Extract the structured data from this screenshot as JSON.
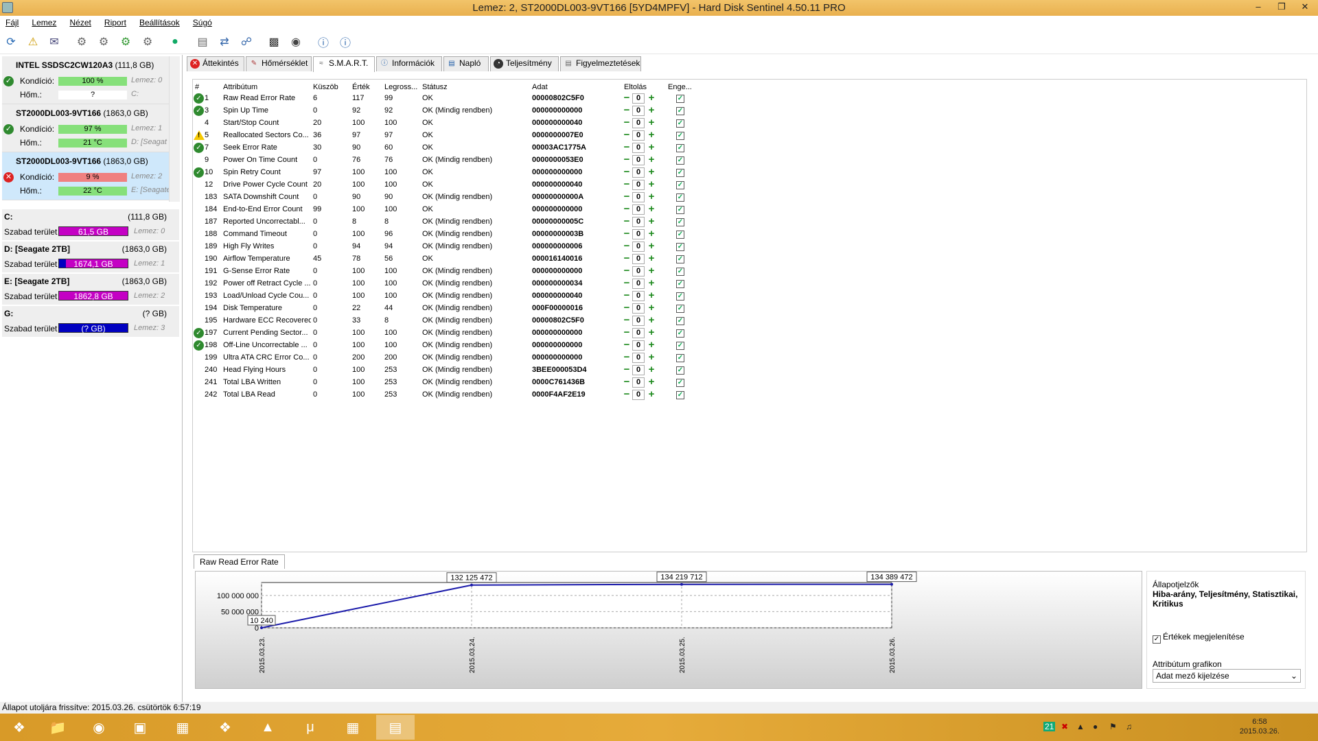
{
  "window": {
    "title": "Lemez: 2, ST2000DL003-9VT166 [5YD4MPFV]  -  Hard Disk Sentinel 4.50.11 PRO"
  },
  "menu": [
    "Fájl",
    "Lemez",
    "Nézet",
    "Riport",
    "Beállítások",
    "Súgó"
  ],
  "disks": [
    {
      "name": "INTEL SSDSC2CW120A3",
      "size": "(111,8 GB)",
      "cond_label": "Kondíció:",
      "cond_value": "100 %",
      "disk_ref": "Lemez: 0",
      "temp_label": "Hőm.:",
      "temp_value": "?",
      "vol_ref": "C:",
      "status": "ok",
      "cond_color": "#86e07a",
      "temp_color": "#fff"
    },
    {
      "name": "ST2000DL003-9VT166",
      "size": "(1863,0 GB)",
      "cond_label": "Kondíció:",
      "cond_value": "97 %",
      "disk_ref": "Lemez: 1",
      "temp_label": "Hőm.:",
      "temp_value": "21 °C",
      "vol_ref": "D: [Seagat",
      "status": "ok",
      "cond_color": "#86e07a",
      "temp_color": "#86e07a"
    },
    {
      "name": "ST2000DL003-9VT166",
      "size": "(1863,0 GB)",
      "cond_label": "Kondíció:",
      "cond_value": "9 %",
      "disk_ref": "Lemez: 2",
      "temp_label": "Hőm.:",
      "temp_value": "22 °C",
      "vol_ref": "E: [Seagate",
      "status": "error",
      "cond_color": "#f08080",
      "temp_color": "#86e07a"
    }
  ],
  "volumes": [
    {
      "name": "C:",
      "size": "(111,8 GB)",
      "free_label": "Szabad terület",
      "free_value": "61,5 GB",
      "disk_ref": "Lemez: 0",
      "color": "#c400c4"
    },
    {
      "name": "D: [Seagate 2TB]",
      "size": "(1863,0 GB)",
      "free_label": "Szabad terület",
      "free_value": "1674,1 GB",
      "disk_ref": "Lemez: 1",
      "color": "#c400c4"
    },
    {
      "name": "E: [Seagate 2TB]",
      "size": "(1863,0 GB)",
      "free_label": "Szabad terület",
      "free_value": "1862,8 GB",
      "disk_ref": "Lemez: 2",
      "color": "#c400c4"
    },
    {
      "name": "G:",
      "size": "(? GB)",
      "free_label": "Szabad terület",
      "free_value": "(? GB)",
      "disk_ref": "Lemez: 3",
      "color": "#0000c0"
    }
  ],
  "tabs": [
    "Áttekintés",
    "Hőmérséklet",
    "S.M.A.R.T.",
    "Információk",
    "Napló",
    "Teljesítmény",
    "Figyelmeztetések"
  ],
  "smart_headers": [
    "#",
    "Attribútum",
    "Küszöb",
    "Érték",
    "Legross...",
    "Státusz",
    "Adat",
    "Eltolás",
    "Enge..."
  ],
  "smart_rows": [
    {
      "icon": "ok",
      "id": "1",
      "name": "Raw Read Error Rate",
      "thr": "6",
      "val": "117",
      "worst": "99",
      "status": "OK",
      "data": "00000802C5F0",
      "offset": "0"
    },
    {
      "icon": "ok",
      "id": "3",
      "name": "Spin Up Time",
      "thr": "0",
      "val": "92",
      "worst": "92",
      "status": "OK (Mindig rendben)",
      "data": "000000000000",
      "offset": "0"
    },
    {
      "icon": "",
      "id": "4",
      "name": "Start/Stop Count",
      "thr": "20",
      "val": "100",
      "worst": "100",
      "status": "OK",
      "data": "000000000040",
      "offset": "0"
    },
    {
      "icon": "warn",
      "id": "5",
      "name": "Reallocated Sectors Co...",
      "thr": "36",
      "val": "97",
      "worst": "97",
      "status": "OK",
      "data": "0000000007E0",
      "offset": "0"
    },
    {
      "icon": "ok",
      "id": "7",
      "name": "Seek Error Rate",
      "thr": "30",
      "val": "90",
      "worst": "60",
      "status": "OK",
      "data": "00003AC1775A",
      "offset": "0"
    },
    {
      "icon": "",
      "id": "9",
      "name": "Power On Time Count",
      "thr": "0",
      "val": "76",
      "worst": "76",
      "status": "OK (Mindig rendben)",
      "data": "0000000053E0",
      "offset": "0"
    },
    {
      "icon": "ok",
      "id": "10",
      "name": "Spin Retry Count",
      "thr": "97",
      "val": "100",
      "worst": "100",
      "status": "OK",
      "data": "000000000000",
      "offset": "0"
    },
    {
      "icon": "",
      "id": "12",
      "name": "Drive Power Cycle Count",
      "thr": "20",
      "val": "100",
      "worst": "100",
      "status": "OK",
      "data": "000000000040",
      "offset": "0"
    },
    {
      "icon": "",
      "id": "183",
      "name": "SATA Downshift Count",
      "thr": "0",
      "val": "90",
      "worst": "90",
      "status": "OK (Mindig rendben)",
      "data": "00000000000A",
      "offset": "0"
    },
    {
      "icon": "",
      "id": "184",
      "name": "End-to-End Error Count",
      "thr": "99",
      "val": "100",
      "worst": "100",
      "status": "OK",
      "data": "000000000000",
      "offset": "0"
    },
    {
      "icon": "",
      "id": "187",
      "name": "Reported Uncorrectabl...",
      "thr": "0",
      "val": "8",
      "worst": "8",
      "status": "OK (Mindig rendben)",
      "data": "00000000005C",
      "offset": "0"
    },
    {
      "icon": "",
      "id": "188",
      "name": "Command Timeout",
      "thr": "0",
      "val": "100",
      "worst": "96",
      "status": "OK (Mindig rendben)",
      "data": "00000000003B",
      "offset": "0"
    },
    {
      "icon": "",
      "id": "189",
      "name": "High Fly Writes",
      "thr": "0",
      "val": "94",
      "worst": "94",
      "status": "OK (Mindig rendben)",
      "data": "000000000006",
      "offset": "0"
    },
    {
      "icon": "",
      "id": "190",
      "name": "Airflow Temperature",
      "thr": "45",
      "val": "78",
      "worst": "56",
      "status": "OK",
      "data": "000016140016",
      "offset": "0"
    },
    {
      "icon": "",
      "id": "191",
      "name": "G-Sense Error Rate",
      "thr": "0",
      "val": "100",
      "worst": "100",
      "status": "OK (Mindig rendben)",
      "data": "000000000000",
      "offset": "0"
    },
    {
      "icon": "",
      "id": "192",
      "name": "Power off Retract Cycle ...",
      "thr": "0",
      "val": "100",
      "worst": "100",
      "status": "OK (Mindig rendben)",
      "data": "000000000034",
      "offset": "0"
    },
    {
      "icon": "",
      "id": "193",
      "name": "Load/Unload Cycle Cou...",
      "thr": "0",
      "val": "100",
      "worst": "100",
      "status": "OK (Mindig rendben)",
      "data": "000000000040",
      "offset": "0"
    },
    {
      "icon": "",
      "id": "194",
      "name": "Disk Temperature",
      "thr": "0",
      "val": "22",
      "worst": "44",
      "status": "OK (Mindig rendben)",
      "data": "000F00000016",
      "offset": "0"
    },
    {
      "icon": "",
      "id": "195",
      "name": "Hardware ECC Recovered",
      "thr": "0",
      "val": "33",
      "worst": "8",
      "status": "OK (Mindig rendben)",
      "data": "00000802C5F0",
      "offset": "0"
    },
    {
      "icon": "ok",
      "id": "197",
      "name": "Current Pending Sector...",
      "thr": "0",
      "val": "100",
      "worst": "100",
      "status": "OK (Mindig rendben)",
      "data": "000000000000",
      "offset": "0"
    },
    {
      "icon": "ok",
      "id": "198",
      "name": "Off-Line Uncorrectable ...",
      "thr": "0",
      "val": "100",
      "worst": "100",
      "status": "OK (Mindig rendben)",
      "data": "000000000000",
      "offset": "0"
    },
    {
      "icon": "",
      "id": "199",
      "name": "Ultra ATA CRC Error Co...",
      "thr": "0",
      "val": "200",
      "worst": "200",
      "status": "OK (Mindig rendben)",
      "data": "000000000000",
      "offset": "0"
    },
    {
      "icon": "",
      "id": "240",
      "name": "Head Flying Hours",
      "thr": "0",
      "val": "100",
      "worst": "253",
      "status": "OK (Mindig rendben)",
      "data": "3BEE000053D4",
      "offset": "0"
    },
    {
      "icon": "",
      "id": "241",
      "name": "Total LBA Written",
      "thr": "0",
      "val": "100",
      "worst": "253",
      "status": "OK (Mindig rendben)",
      "data": "0000C761436B",
      "offset": "0"
    },
    {
      "icon": "",
      "id": "242",
      "name": "Total LBA Read",
      "thr": "0",
      "val": "100",
      "worst": "253",
      "status": "OK (Mindig rendben)",
      "data": "0000F4AF2E19",
      "offset": "0"
    }
  ],
  "chart_tab": "Raw Read Error Rate",
  "chart_data": {
    "type": "line",
    "x": [
      "2015.03.23.",
      "2015.03.24.",
      "2015.03.25.",
      "2015.03.26."
    ],
    "values": [
      10240,
      132125472,
      134219712,
      134389472
    ],
    "data_labels": [
      "10 240",
      "132 125 472",
      "134 219 712",
      "134 389 472"
    ],
    "y_ticks": [
      "100 000 000",
      "50 000 000",
      "0"
    ],
    "y_tick_values": [
      100000000,
      50000000,
      0
    ],
    "ylim": [
      0,
      140000000
    ],
    "grid": true,
    "line_color": "#1a1aaa"
  },
  "side": {
    "heading": "Állapotjelzők",
    "bold": "Hiba-arány, Teljesítmény, Statisztikai, Kritikus",
    "checkbox_label": "Értékek megjelenítése",
    "attr_label": "Attribútum grafikon",
    "select_value": "Adat mező kijelzése"
  },
  "status_bar": "Állapot utoljára frissítve: 2015.03.26. csütörtök 6:57:19",
  "clock": {
    "time": "6:58",
    "date": "2015.03.26."
  },
  "tray_badge": "21"
}
